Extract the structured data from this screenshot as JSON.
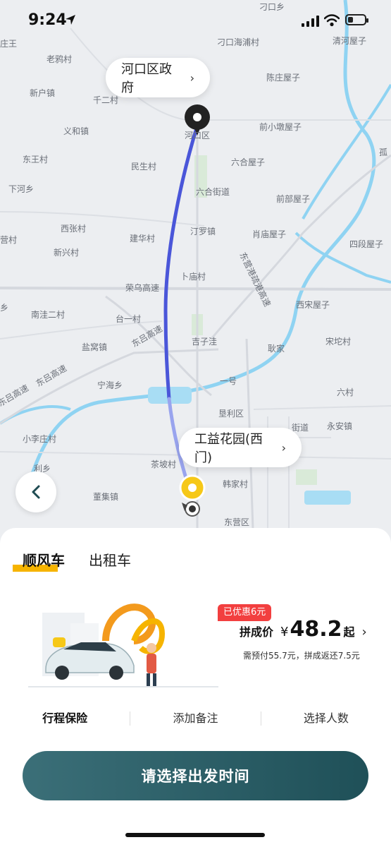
{
  "status_bar": {
    "time": "9:24"
  },
  "map": {
    "labels": [
      "刁口乡",
      "刁口海浦村",
      "清河屋子",
      "老鸦村",
      "新户镇",
      "千二村",
      "陈庄屋子",
      "义和镇",
      "河口区",
      "前小墩屋子",
      "东王村",
      "民生村",
      "六合屋子",
      "下河乡",
      "六合街道",
      "前部屋子",
      "西张村",
      "建华村",
      "汀罗镇",
      "肖庙屋子",
      "四段屋子",
      "新兴村",
      "营村",
      "卜庙村",
      "荣乌高速",
      "西宋屋子",
      "南洼二村",
      "台一村",
      "东营港疏港高速",
      "盐窝镇",
      "东吕高速",
      "吉子洼",
      "耿家",
      "宋坨村",
      "宁海乡",
      "东吕高速",
      "一号",
      "六村",
      "小李庄村",
      "垦利区",
      "街道",
      "永安镇",
      "东吕高速",
      "茶坡村",
      "利乡",
      "董集镇",
      "韩家村",
      "东营区",
      "孤",
      "乡",
      "庄王"
    ],
    "destination_bubble": "河口区政府",
    "origin_bubble": "工益花园(西门)"
  },
  "sheet": {
    "tabs": [
      {
        "label": "顺风车",
        "active": true
      },
      {
        "label": "出租车",
        "active": false
      }
    ],
    "discount_badge": "已优惠6元",
    "price_label": "拼成价",
    "currency": "¥",
    "price": "48.2",
    "price_suffix": "起",
    "price_note": "需预付55.7元，拼成返还7.5元",
    "options": [
      "行程保险",
      "添加备注",
      "选择人数"
    ],
    "cta": "请选择出发时间"
  },
  "colors": {
    "route": "#4a56d9",
    "cta": "#2a5c64",
    "accent": "#f6b400",
    "discount": "#f23f3f"
  }
}
